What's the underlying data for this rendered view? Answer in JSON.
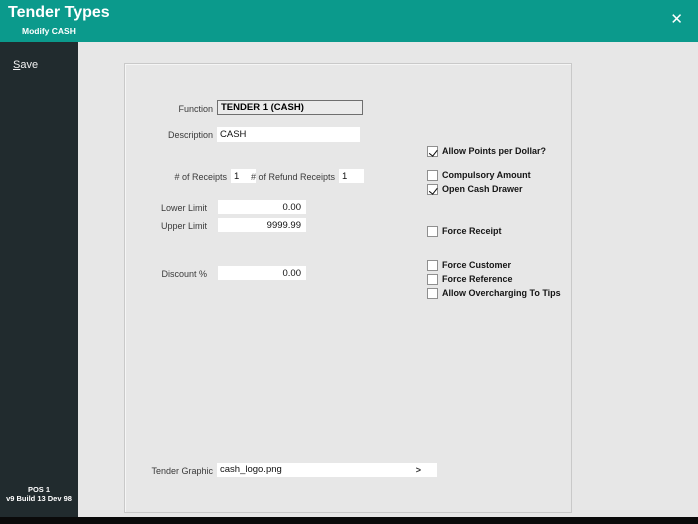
{
  "window": {
    "title": "Tender Types",
    "subtitle": "Modify CASH"
  },
  "icons": {
    "close": "✕",
    "browse": ">"
  },
  "sidebar": {
    "save_label": "Save",
    "footer_line1": "POS 1",
    "footer_line2": "v9 Build 13 Dev 98"
  },
  "colors": {
    "header_teal": "#0b9a8c",
    "sidebar_dark": "#212b2e",
    "panel_border": "#c9c9c9"
  },
  "form": {
    "function": {
      "label": "Function",
      "value": "TENDER 1 (CASH)"
    },
    "description": {
      "label": "Description",
      "value": "CASH"
    },
    "receipts": {
      "label": "# of Receipts",
      "value": "1"
    },
    "refund_receipts": {
      "label": "# of Refund Receipts",
      "value": "1"
    },
    "lower_limit": {
      "label": "Lower Limit",
      "value": "0.00"
    },
    "upper_limit": {
      "label": "Upper Limit",
      "value": "9999.99"
    },
    "discount": {
      "label": "Discount %",
      "value": "0.00"
    },
    "tender_graphic": {
      "label": "Tender Graphic",
      "value": "cash_logo.png"
    },
    "checkboxes": [
      {
        "label": "Allow Points per Dollar?",
        "checked": true
      },
      {
        "label": "Compulsory Amount",
        "checked": false
      },
      {
        "label": "Open Cash Drawer",
        "checked": true
      },
      {
        "label": "Force Receipt",
        "checked": false
      },
      {
        "label": "Force Customer",
        "checked": false
      },
      {
        "label": "Force Reference",
        "checked": false
      },
      {
        "label": "Allow Overcharging To Tips",
        "checked": false
      }
    ]
  }
}
